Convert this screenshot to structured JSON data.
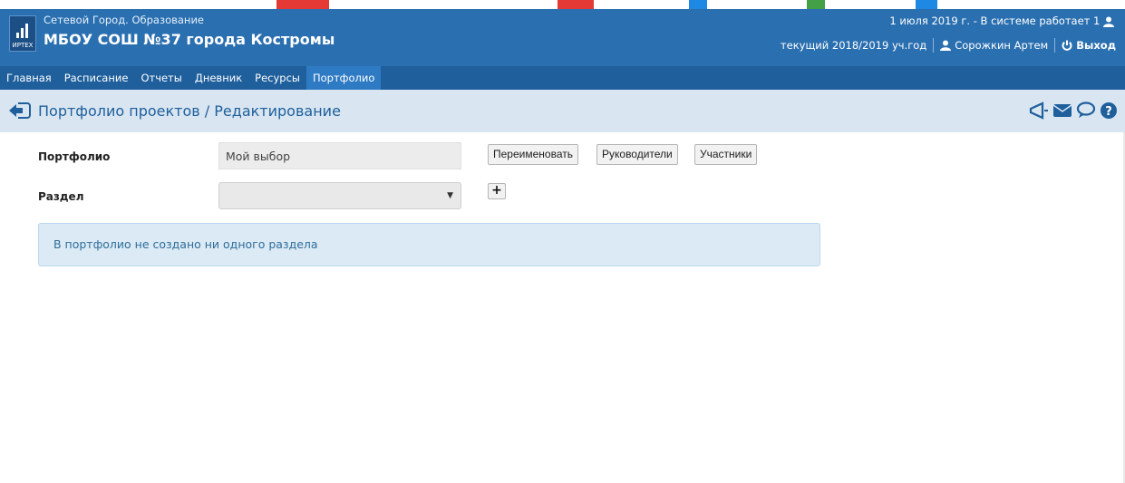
{
  "header": {
    "brand": "Сетевой Город. Образование",
    "school": "МБОУ СОШ №37 города Костромы",
    "logo_text": "ИРТЕХ",
    "status_line": "1 июля 2019 г. - В системе работает 1",
    "year": "текущий 2018/2019 уч.год",
    "user": "Сорожкин Артем",
    "logout": "Выход"
  },
  "nav": {
    "items": [
      "Главная",
      "Расписание",
      "Отчеты",
      "Дневник",
      "Ресурсы",
      "Портфолио"
    ],
    "active_index": 5
  },
  "page": {
    "title": "Портфолио проектов / Редактирование"
  },
  "form": {
    "portfolio_label": "Портфолио",
    "portfolio_value": "Мой выбор",
    "section_label": "Раздел",
    "section_value": "",
    "rename_button": "Переименовать",
    "managers_button": "Руководители",
    "participants_button": "Участники",
    "add_button": "+"
  },
  "info": {
    "message": "В портфолио не создано ни одного раздела"
  },
  "icons": {
    "back": "arrow-left-icon",
    "logo": "irtech-logo-icon",
    "user": "user-icon",
    "logout": "power-icon",
    "announce": "megaphone-icon",
    "mail": "envelope-icon",
    "chat": "chat-icon",
    "help": "question-icon"
  },
  "colors": {
    "header": "#2a6fb0",
    "nav": "#1e5f9c",
    "nav_active": "#2e7bc4",
    "titlebar": "#d9e6f2",
    "info_bg": "#dbeaf5",
    "info_text": "#2f6d9a"
  }
}
